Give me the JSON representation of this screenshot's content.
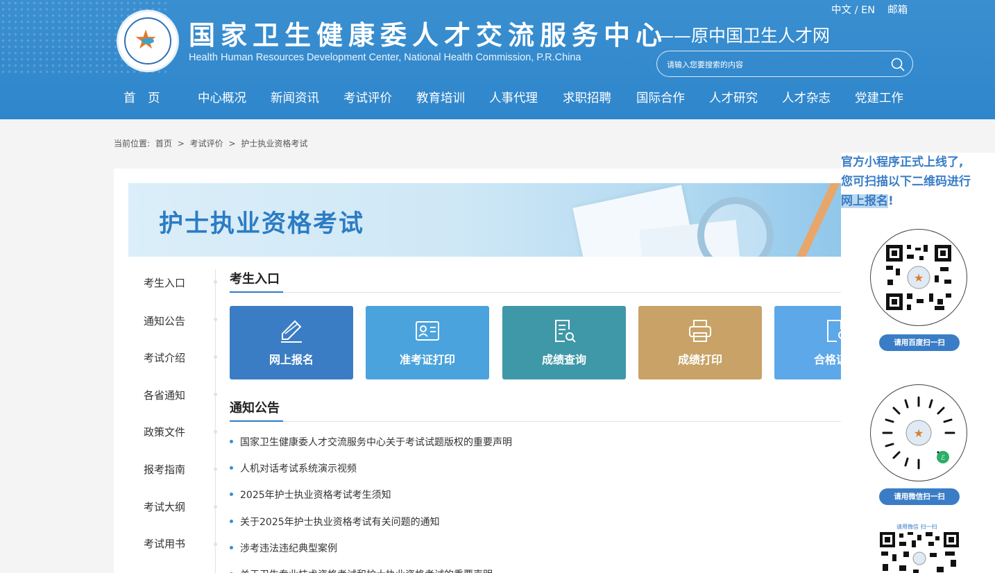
{
  "header": {
    "title_cn": "国家卫生健康委人才交流服务中心",
    "title_en": "Health Human Resources Development Center, National Health Commission, P.R.China",
    "subtitle": "——原中国卫生人才网",
    "lang_label": "中文 / EN",
    "mail_label": "邮箱",
    "search_placeholder": "请输入您要搜索的内容",
    "bg_color": "#3a8fd0"
  },
  "nav": {
    "items": [
      "首　页",
      "中心概况",
      "新闻资讯",
      "考试评价",
      "教育培训",
      "人事代理",
      "求职招聘",
      "国际合作",
      "人才研究",
      "人才杂志",
      "党建工作"
    ]
  },
  "breadcrumb": {
    "prefix": "当前位置:",
    "items": [
      "首页",
      ">",
      "考试评价",
      ">",
      "护士执业资格考试"
    ]
  },
  "banner": {
    "title": "护士执业资格考试"
  },
  "sidebar": {
    "items": [
      "考生入口",
      "通知公告",
      "考试介绍",
      "各省通知",
      "政策文件",
      "报考指南",
      "考试大纲",
      "考试用书"
    ]
  },
  "entry": {
    "section_title": "考生入口",
    "tiles": [
      {
        "label": "网上报名",
        "color": "#3b7dc4",
        "icon": "pencil-icon"
      },
      {
        "label": "准考证打印",
        "color": "#4aa3dc",
        "icon": "id-card-icon"
      },
      {
        "label": "成绩查询",
        "color": "#3e98a8",
        "icon": "search-document-icon"
      },
      {
        "label": "成绩打印",
        "color": "#c8a267",
        "icon": "printer-icon"
      },
      {
        "label": "合格证明",
        "color": "#5da8e8",
        "icon": "certificate-icon"
      }
    ]
  },
  "notices": {
    "section_title": "通知公告",
    "items": [
      "国家卫生健康委人才交流服务中心关于考试试题版权的重要声明",
      "人机对话考试系统演示视频",
      "2025年护士执业资格考试考生须知",
      "关于2025年护士执业资格考试有关问题的通知",
      "涉考违法违纪典型案例",
      "关于卫生专业技术资格考试和护士执业资格考试的重要声明"
    ]
  },
  "float_panel": {
    "promo_line1": "官方小程序正式上线了,",
    "promo_line2": "您可扫描以下二维码进行",
    "promo_line3": "网上报名",
    "promo_bang": "!",
    "btn_baidu": "请用百度扫一扫",
    "btn_wechat": "请用微信扫一扫",
    "tiny_label": "请用微信 扫一扫"
  }
}
